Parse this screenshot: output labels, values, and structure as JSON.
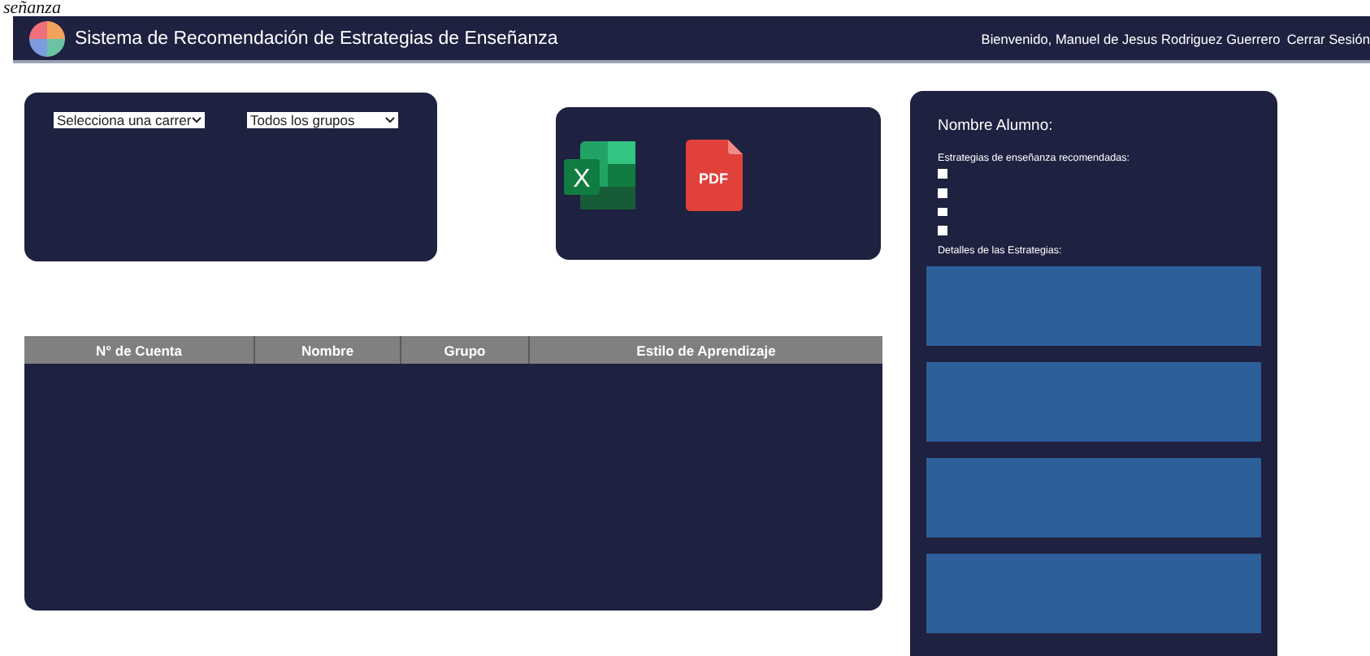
{
  "caption": "señanza",
  "header": {
    "title": "Sistema de Recomendación de Estrategias de Enseñanza",
    "welcome": "Bienvenido, Manuel de Jesus Rodriguez Guerrero",
    "logout": "Cerrar Sesión"
  },
  "filters": [
    {
      "value": "Selecciona una carrer"
    },
    {
      "value": "Todos los grupos"
    }
  ],
  "exports": [
    {
      "kind": "excel",
      "label": "X"
    },
    {
      "kind": "pdf",
      "label": "PDF"
    }
  ],
  "table": {
    "columns": [
      "N° de Cuenta",
      "Nombre",
      "Grupo",
      "Estilo de Aprendizaje"
    ]
  },
  "student_panel": {
    "title": "Nombre Alumno:",
    "strategies_label": "Estrategias de enseñanza recomendadas:",
    "details_label": "Detalles de las Estrategias:"
  }
}
